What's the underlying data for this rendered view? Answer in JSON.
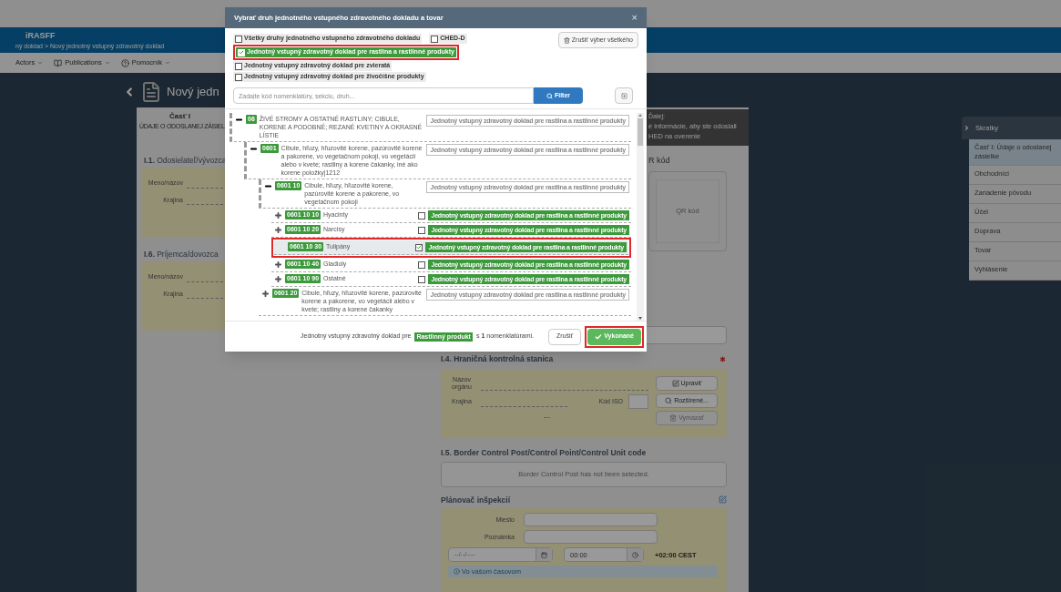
{
  "header": {
    "app_name": "iRASFF",
    "breadcrumb": "ný doklad > Nový jednotný vstupný zdravotný doklad"
  },
  "menu": [
    {
      "label": "Actors",
      "kind": "plain"
    },
    {
      "label": "Publications",
      "kind": "book"
    },
    {
      "label": "Pomocník",
      "kind": "help"
    }
  ],
  "page_title": "Nový jedn",
  "part": {
    "title": "Časť I",
    "subtitle": "ÚDAJE O ODOSLANEJ ZÁSIEL"
  },
  "left_sections": [
    {
      "heading": "**I.1.** Odosielateľ/vývozca",
      "fields": [
        "Meno/názov",
        "Krajina"
      ]
    },
    {
      "heading": "**I.6.** Príjemca/dovozca",
      "fields": [
        "Meno/názov",
        "Krajina"
      ]
    }
  ],
  "next_box": {
    "title": "Ďalej:",
    "lines": [
      "é informácie, aby ste odoslali",
      "HED na overenie"
    ]
  },
  "qr": {
    "heading": "R kód",
    "placeholder": "QR kód"
  },
  "border_station": {
    "heading": "**I.4.** Hraničná kontrolná stanica",
    "required": true,
    "name_label": "Názov orgánu",
    "country_label": "Krajina",
    "iso_label": "Kód ISO",
    "empty_mark": "---",
    "buttons": [
      {
        "label": "Upraviť",
        "kind": "edit",
        "disabled": false
      },
      {
        "label": "Rozšírené...",
        "kind": "search",
        "disabled": false
      },
      {
        "label": "Vymazať",
        "kind": "delete",
        "disabled": true
      }
    ]
  },
  "bcp": {
    "heading": "**I.5.** Border Control Post/Control Point/Control Unit code",
    "message": "Border Control Post has not been selected."
  },
  "planner": {
    "heading": "Plánovač inšpekcií",
    "fields": [
      "Miesto",
      "Poznámka"
    ],
    "date_placeholder": "--/--/----",
    "time": "00:00",
    "timezone": "+02:00 CEST",
    "info": "Vo vašom časovom"
  },
  "shortcuts": {
    "title": "Skratky",
    "items": [
      {
        "label": "Časť I: Údaje o odoslanej zásielke",
        "selected": true
      },
      {
        "label": "Obchodníci",
        "selected": false
      },
      {
        "label": "Zariadenie pôvodu",
        "selected": false
      },
      {
        "label": "Účel",
        "selected": false
      },
      {
        "label": "Doprava",
        "selected": false
      },
      {
        "label": "Tovar",
        "selected": false
      },
      {
        "label": "Vyhlásenie",
        "selected": false
      }
    ]
  },
  "modal": {
    "title": "Vybrať druh jednotného vstupného zdravotného dokladu a tovar",
    "close": "×",
    "option_rows": [
      {
        "options": [
          {
            "label": "Všetky druhy jednotného vstupného zdravotného dokladu",
            "checked": false,
            "highlighted": false
          },
          {
            "label": "CHED-D",
            "checked": false,
            "highlighted": false
          }
        ]
      },
      {
        "options": [
          {
            "label": "Jednotný vstupný zdravotný doklad pre rastlina a rastlinné produkty",
            "checked": true,
            "highlighted": true
          }
        ]
      },
      {
        "options": [
          {
            "label": "Jednotný vstupný zdravotný doklad pre zvieratá",
            "checked": false,
            "highlighted": false
          }
        ]
      },
      {
        "options": [
          {
            "label": "Jednotný vstupný zdravotný doklad pre živočíšne produkty",
            "checked": false,
            "highlighted": false
          }
        ]
      }
    ],
    "clear_button": "Zrušiť výber všetkého",
    "search": {
      "placeholder": "Zadajte kód nomenklatúry, sekciu, druh..."
    },
    "filter_button": "Filter",
    "tree": [
      {
        "code": "06",
        "text": "ŽIVÉ STROMY A OSTATNÉ RASTLINY; CIBULE, KORENE A PODOBNÉ; REZANÉ KVETINY A OKRASNÉ LÍSTIE",
        "kind": "group",
        "expanded": true,
        "doc": "Jednotný vstupný zdravotný doklad pre rastlina a rastlinné produkty",
        "children": [
          {
            "code": "0601",
            "text": "Cibule, hľuzy, hľuzovité korene, pazúrovité korene a pakorene, vo vegetačnom pokoji, vo vegetácii alebo v kvete; rastliny a korene čakanky, iné ako korene položky|1212",
            "kind": "group",
            "expanded": true,
            "doc": "Jednotný vstupný zdravotný doklad pre rastlina a rastlinné produkty",
            "children": [
              {
                "code": "0601 10",
                "text": "Cibule, hľuzy, hľuzovité korene, pazúrovité korene a pakorene, vo vegetačnom pokoji",
                "kind": "group",
                "expanded": true,
                "doc": "Jednotný vstupný zdravotný doklad pre rastlina a rastlinné produkty",
                "children": [
                  {
                    "code": "0601 10 10",
                    "text": "Hyacinty",
                    "kind": "item",
                    "expanded": false,
                    "checked": false,
                    "selected": false,
                    "highlighted": false,
                    "doc": "Jednotný vstupný zdravotný doklad pre rastlina a rastlinné produkty"
                  },
                  {
                    "code": "0601 10 20",
                    "text": "Narcisy",
                    "kind": "item",
                    "expanded": false,
                    "checked": false,
                    "selected": false,
                    "highlighted": false,
                    "doc": "Jednotný vstupný zdravotný doklad pre rastlina a rastlinné produkty"
                  },
                  {
                    "code": "0601 10 30",
                    "text": "Tulipány",
                    "kind": "item",
                    "checked": true,
                    "selected": true,
                    "highlighted": true,
                    "doc": "Jednotný vstupný zdravotný doklad pre rastlina a rastlinné produkty"
                  },
                  {
                    "code": "0601 10 40",
                    "text": "Gladioly",
                    "kind": "item",
                    "expanded": false,
                    "checked": false,
                    "selected": false,
                    "highlighted": false,
                    "doc": "Jednotný vstupný zdravotný doklad pre rastlina a rastlinné produkty"
                  },
                  {
                    "code": "0601 10 90",
                    "text": "Ostatné",
                    "kind": "item",
                    "expanded": false,
                    "checked": false,
                    "selected": false,
                    "highlighted": false,
                    "doc": "Jednotný vstupný zdravotný doklad pre rastlina a rastlinné produkty"
                  }
                ]
              },
              {
                "code": "0601 20",
                "text": "Cibule, hľuzy, hľuzovité korene, pazúrovité korene a pakorene, vo vegetácii alebo v kvete; rastliny a korene čakanky",
                "kind": "group",
                "expanded": false,
                "doc": "Jednotný vstupný zdravotný doklad pre rastlina a rastlinné produkty"
              }
            ]
          }
        ]
      }
    ],
    "footer": {
      "prefix": "Jednotný vstupný zdravotný doklad pre",
      "badge": "Rastlinný produkt",
      "suffix": "s **1** nomenklatúrami.",
      "buttons": [
        {
          "label": "Zrušiť",
          "kind": "cancel",
          "highlighted": false
        },
        {
          "label": "Vykonané",
          "kind": "confirm",
          "highlighted": true
        }
      ]
    }
  }
}
